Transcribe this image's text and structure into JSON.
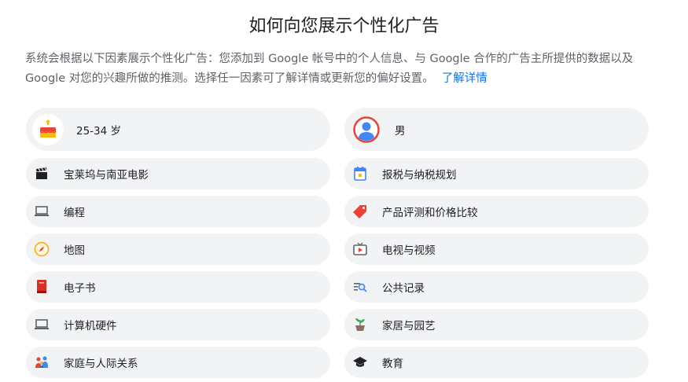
{
  "header": {
    "title": "如何向您展示个性化广告",
    "description": "系统会根据以下因素展示个性化广告：您添加到 Google 帐号中的个人信息、与 Google 合作的广告主所提供的数据以及 Google 对您的兴趣所做的推测。选择任一因素可了解详情或更新您的偏好设置。",
    "learn_more": "了解详情"
  },
  "factors": {
    "left": [
      {
        "label": "25-34 岁",
        "icon": "birthday-cake-icon"
      },
      {
        "label": "宝莱坞与南亚电影",
        "icon": "clapperboard-icon"
      },
      {
        "label": "编程",
        "icon": "laptop-icon"
      },
      {
        "label": "地图",
        "icon": "compass-icon"
      },
      {
        "label": "电子书",
        "icon": "ebook-icon"
      },
      {
        "label": "计算机硬件",
        "icon": "laptop-icon"
      },
      {
        "label": "家庭与人际关系",
        "icon": "people-icon"
      }
    ],
    "right": [
      {
        "label": "男",
        "icon": "person-avatar-icon"
      },
      {
        "label": "报税与纳税规划",
        "icon": "calendar-icon"
      },
      {
        "label": "产品评测和价格比较",
        "icon": "price-tag-icon"
      },
      {
        "label": "电视与视频",
        "icon": "tv-icon"
      },
      {
        "label": "公共记录",
        "icon": "records-search-icon"
      },
      {
        "label": "家居与园艺",
        "icon": "potted-plant-icon"
      },
      {
        "label": "教育",
        "icon": "graduation-cap-icon"
      }
    ]
  },
  "colors": {
    "card_bg": "#f1f3f4",
    "link": "#1a73e8",
    "text": "#202124",
    "muted": "#5f6368"
  }
}
